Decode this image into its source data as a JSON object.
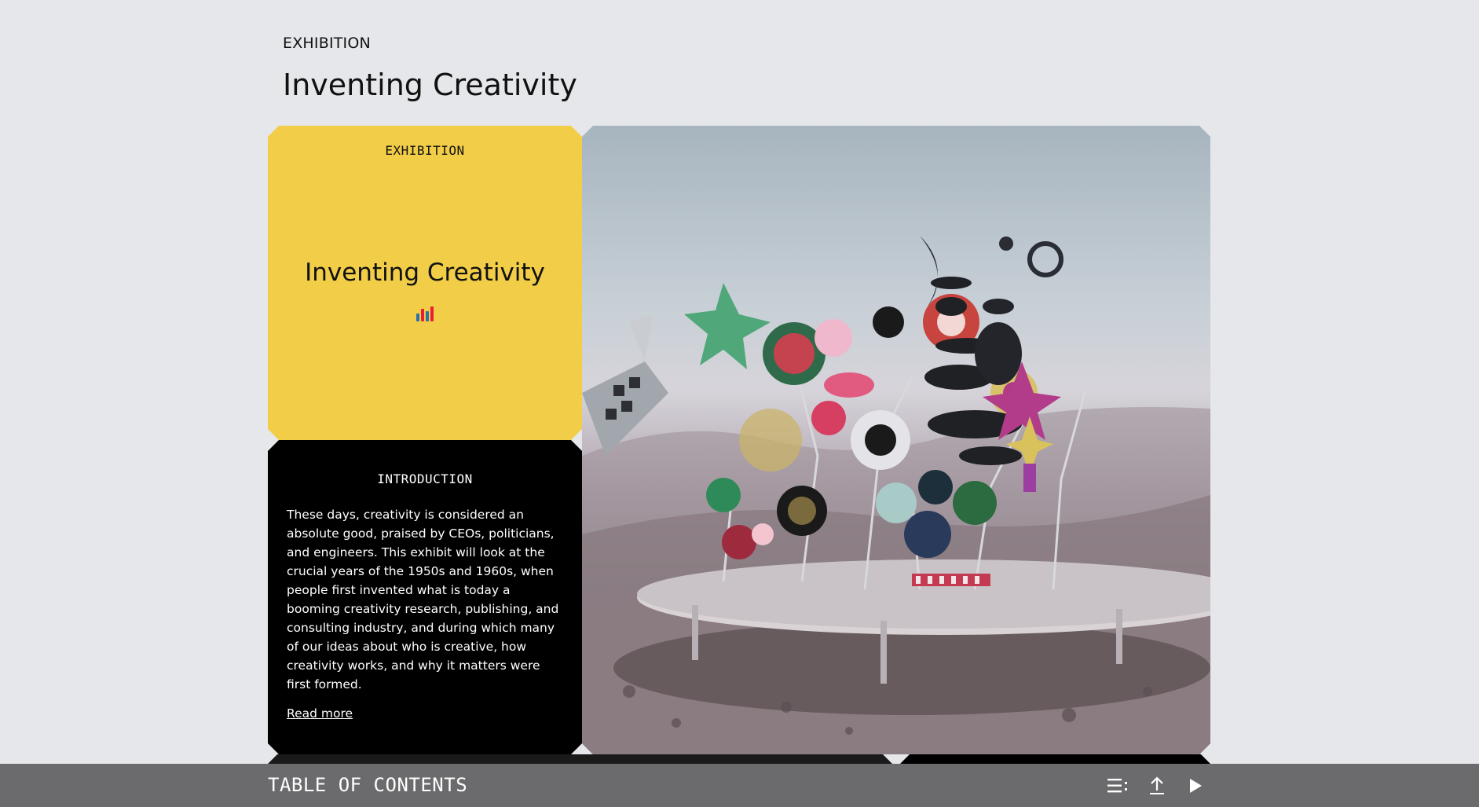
{
  "header": {
    "eyebrow": "EXHIBITION",
    "title": "Inventing Creativity"
  },
  "cover_card": {
    "kicker": "EXHIBITION",
    "title": "Inventing Creativity",
    "logo_icon": "iiif-logo-icon",
    "colors": {
      "background": "#f2cd48"
    }
  },
  "intro_card": {
    "kicker": "INTRODUCTION",
    "text": "These days, creativity is considered an absolute good, praised by CEOs, politicians, and engineers. This exhibit will look at the crucial years of the 1950s and 1960s, when people first invented what is today a booming creativity research, publishing, and consulting industry, and during which many of our ideas about who is creative, how creativity works, and why it matters were first formed.",
    "read_more": "Read more"
  },
  "image_card": {
    "image_icon": "exhibition-photo"
  },
  "toc_bar": {
    "label": "TABLE OF CONTENTS",
    "icons": [
      "list-icon",
      "upload-icon",
      "play-icon"
    ],
    "colors": {
      "background": "#6b6b6d"
    }
  }
}
